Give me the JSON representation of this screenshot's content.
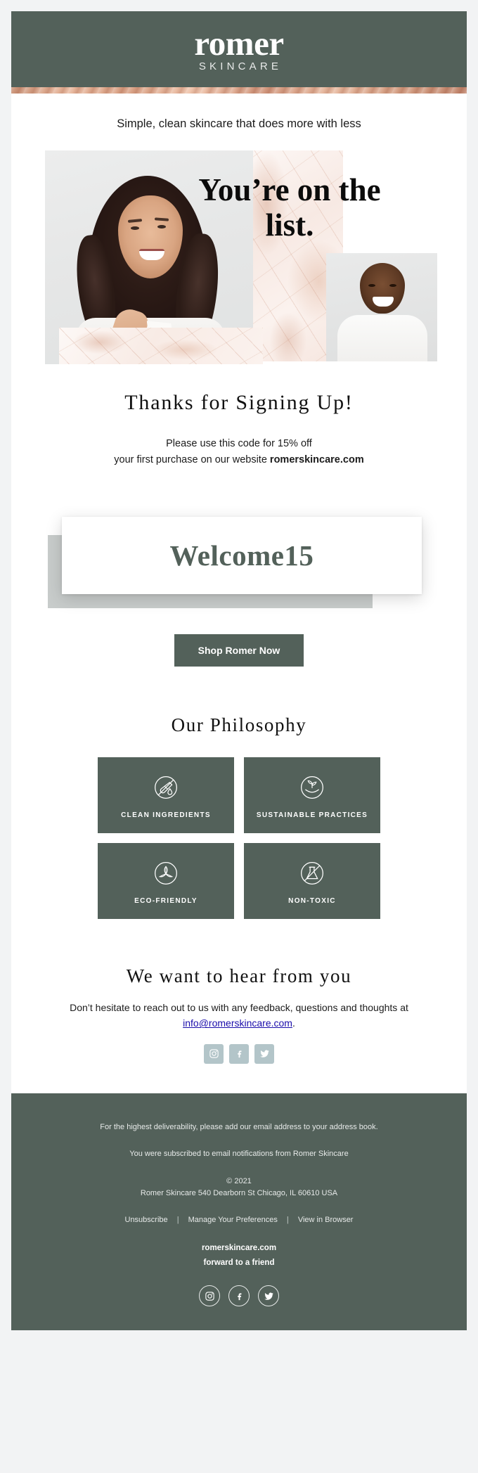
{
  "brand": {
    "name": "romer",
    "sub": "SKINCARE",
    "green": "#53615a",
    "copper": "#d79c7e"
  },
  "tagline": "Simple, clean skincare that does more with less",
  "hero": {
    "headline": "You’re on the list."
  },
  "thanks": {
    "title": "Thanks  for  Signing  Up!",
    "line1": "Please use this code for 15% off",
    "line2_pre": "your first purchase on our website ",
    "line2_bold": "romerskincare.com"
  },
  "promo": {
    "code": "Welcome15"
  },
  "cta": {
    "label": "Shop Romer Now"
  },
  "philosophy": {
    "title": "Our  Philosophy",
    "tiles": [
      {
        "label": "CLEAN INGREDIENTS",
        "icon": "no-dropper-icon"
      },
      {
        "label": "SUSTAINABLE PRACTICES",
        "icon": "hand-plant-icon"
      },
      {
        "label": "ECO-FRIENDLY",
        "icon": "leaf-trio-icon"
      },
      {
        "label": "NON-TOXIC",
        "icon": "no-flask-icon"
      }
    ]
  },
  "contact": {
    "title": "We  want  to  hear  from  you",
    "copy_pre": "Don’t hesitate to reach out to us with any feedback, questions and thoughts at ",
    "email": "info@romerskincare.com",
    "copy_post": ".",
    "socials": [
      "instagram-icon",
      "facebook-icon",
      "twitter-icon"
    ]
  },
  "footer": {
    "deliverability": "For the highest deliverability, please add our email address to your address book.",
    "subscribed": "You were subscribed to email notifications from Romer Skincare",
    "copyright": "© 2021",
    "address": "Romer Skincare 540 Dearborn St Chicago, IL 60610 USA",
    "links": [
      "Unsubscribe",
      "Manage Your Preferences",
      "View in Browser"
    ],
    "separator": "|",
    "site": "romerskincare.com",
    "forward": "forward to a friend",
    "socials": [
      "instagram-icon",
      "facebook-icon",
      "twitter-icon"
    ]
  }
}
